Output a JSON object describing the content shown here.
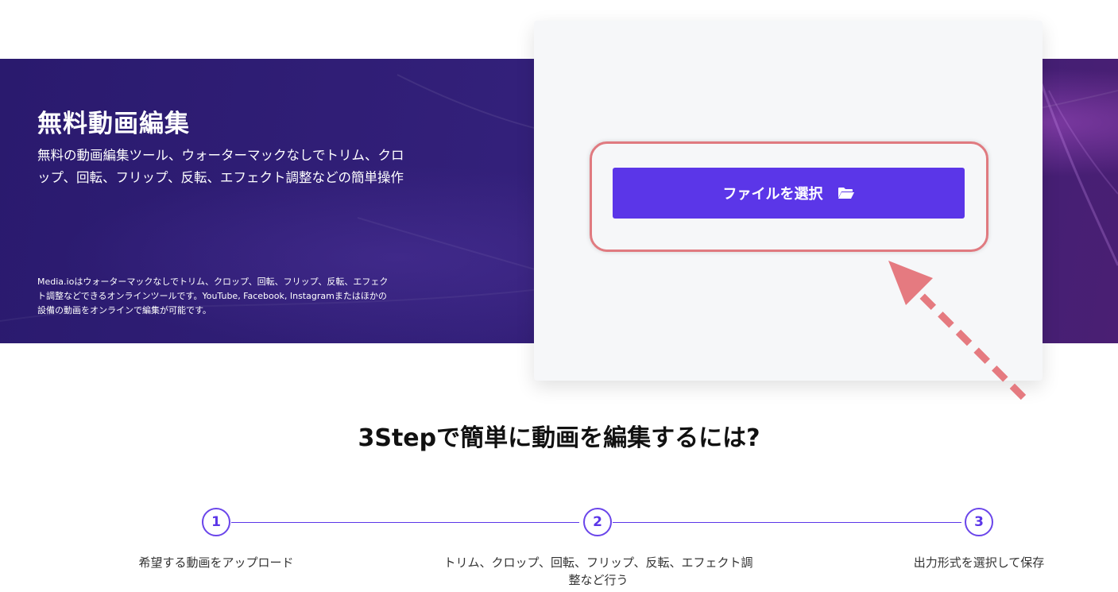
{
  "hero": {
    "title": "無料動画編集",
    "description": "無料の動画編集ツール、ウォーターマックなしでトリム、クロップ、回転、フリップ、反転、エフェクト調整などの簡単操作",
    "note": "Media.ioはウォーターマックなしでトリム、クロップ、回転、フリップ、反転、エフェクト調整などできるオンラインツールです。YouTube, Facebook, Instagramまたはほかの設備の動画をオンラインで編集が可能です。"
  },
  "upload": {
    "button_label": "ファイルを選択",
    "button_icon": "folder-open-icon"
  },
  "steps": {
    "title": "3Stepで簡単に動画を編集するには?",
    "items": [
      {
        "number": "1",
        "label": "希望する動画をアップロード"
      },
      {
        "number": "2",
        "label": "トリム、クロップ、回転、フリップ、反転、エフェクト調整など行う"
      },
      {
        "number": "3",
        "label": "出力形式を選択して保存"
      }
    ]
  },
  "colors": {
    "accent": "#5b36e8",
    "highlight": "#e07a80",
    "hero_bg": "#2f1d74"
  }
}
